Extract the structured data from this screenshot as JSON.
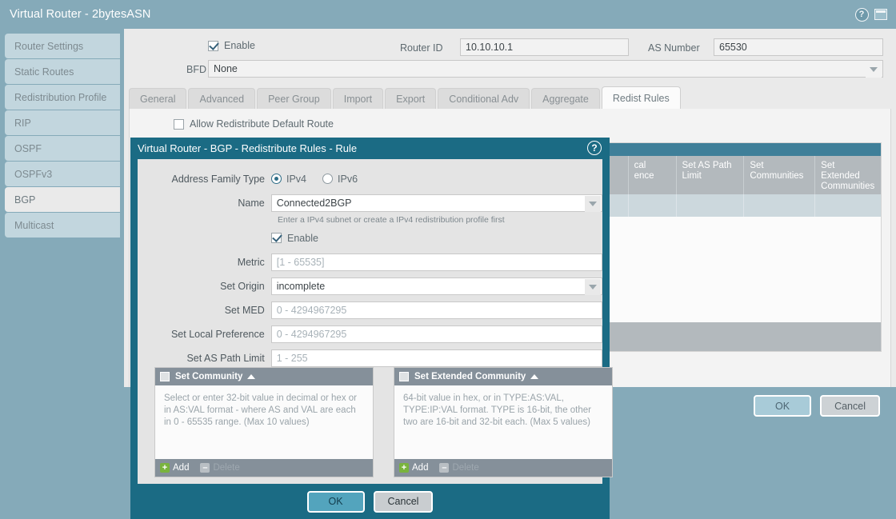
{
  "window": {
    "title": "Virtual Router - 2bytesASN",
    "help_icon": "help-circle-icon",
    "window_icon": "window-restore-icon"
  },
  "sidebar": {
    "items": [
      {
        "label": "Router Settings",
        "selected": false
      },
      {
        "label": "Static Routes",
        "selected": false
      },
      {
        "label": "Redistribution Profile",
        "selected": false
      },
      {
        "label": "RIP",
        "selected": false
      },
      {
        "label": "OSPF",
        "selected": false
      },
      {
        "label": "OSPFv3",
        "selected": false
      },
      {
        "label": "BGP",
        "selected": true
      },
      {
        "label": "Multicast",
        "selected": false
      }
    ]
  },
  "bgp_form": {
    "enable_label": "Enable",
    "enable_checked": true,
    "router_id_label": "Router ID",
    "router_id_value": "10.10.10.1",
    "as_number_label": "AS Number",
    "as_number_value": "65530",
    "bfd_label": "BFD",
    "bfd_value": "None"
  },
  "tabs": [
    {
      "label": "General",
      "selected": false
    },
    {
      "label": "Advanced",
      "selected": false
    },
    {
      "label": "Peer Group",
      "selected": false
    },
    {
      "label": "Import",
      "selected": false
    },
    {
      "label": "Export",
      "selected": false
    },
    {
      "label": "Conditional Adv",
      "selected": false
    },
    {
      "label": "Aggregate",
      "selected": false
    },
    {
      "label": "Redist Rules",
      "selected": true
    }
  ],
  "redist_panel": {
    "allow_default_route_label": "Allow Redistribute Default Route",
    "allow_default_route_checked": false,
    "table_headers": [
      "cal\nence",
      "Set AS Path Limit",
      "Set Communities",
      "Set Extended Communities"
    ],
    "table_header_0_line1": "cal",
    "table_header_0_line2": "ence",
    "table_header_1_line1": "Set AS Path",
    "table_header_1_line2": "Limit",
    "table_header_2_line1": "Set",
    "table_header_2_line2": "Communities",
    "table_header_3_line1": "Set Extended",
    "table_header_3_line2": "Communities"
  },
  "outer_buttons": {
    "ok": "OK",
    "cancel": "Cancel"
  },
  "modal": {
    "title": "Virtual Router - BGP - Redistribute Rules - Rule",
    "help_icon": "help-circle-icon",
    "address_family": {
      "label": "Address Family Type",
      "options": [
        "IPv4",
        "IPv6"
      ],
      "selected": "IPv4"
    },
    "name": {
      "label": "Name",
      "value": "Connected2BGP",
      "hint": "Enter a IPv4 subnet or create a IPv4 redistribution profile first"
    },
    "enable": {
      "label": "Enable",
      "checked": true
    },
    "metric": {
      "label": "Metric",
      "value": "",
      "placeholder": "[1 - 65535]"
    },
    "set_origin": {
      "label": "Set Origin",
      "value": "incomplete"
    },
    "set_med": {
      "label": "Set MED",
      "value": "",
      "placeholder": "0 - 4294967295"
    },
    "set_local_preference": {
      "label": "Set Local Preference",
      "value": "",
      "placeholder": "0 - 4294967295"
    },
    "set_as_path_limit": {
      "label": "Set AS Path Limit",
      "value": "",
      "placeholder": "1 - 255"
    },
    "set_community": {
      "title": "Set Community",
      "checked": false,
      "body": "Select or enter 32-bit value in decimal or hex or in AS:VAL format - where AS and VAL are each in 0 - 65535 range. (Max 10 values)",
      "add_label": "Add",
      "delete_label": "Delete",
      "delete_disabled": true
    },
    "set_extended_community": {
      "title": "Set Extended Community",
      "checked": false,
      "body": "64-bit value in hex, or in TYPE:AS:VAL, TYPE:IP:VAL format. TYPE is 16-bit, the other two are 16-bit and 32-bit each. (Max 5 values)",
      "add_label": "Add",
      "delete_label": "Delete",
      "delete_disabled": true
    },
    "buttons": {
      "ok": "OK",
      "cancel": "Cancel"
    }
  },
  "colors": {
    "titlebar": "#85aab9",
    "modal_frame": "#1b6b84",
    "table_header": "#3f7f99",
    "accent_green": "#79b33d"
  }
}
